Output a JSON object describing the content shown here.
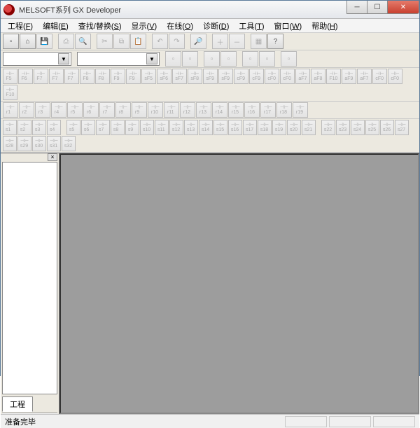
{
  "titlebar": {
    "title": "MELSOFT系列 GX Developer"
  },
  "menu": {
    "items": [
      {
        "label": "工程",
        "key": "F"
      },
      {
        "label": "编辑",
        "key": "E"
      },
      {
        "label": "查找/替换",
        "key": "S"
      },
      {
        "label": "显示",
        "key": "V"
      },
      {
        "label": "在线",
        "key": "O"
      },
      {
        "label": "诊断",
        "key": "D"
      },
      {
        "label": "工具",
        "key": "T"
      },
      {
        "label": "窗口",
        "key": "W"
      },
      {
        "label": "帮助",
        "key": "H"
      }
    ]
  },
  "toolbar1": {
    "buttons": [
      "new",
      "open",
      "save",
      "sep",
      "print",
      "preview",
      "sep",
      "cut",
      "copy",
      "paste",
      "sep",
      "undo",
      "redo",
      "sep",
      "find",
      "sep",
      "zoom-in",
      "zoom-out",
      "sep",
      "tile",
      "help"
    ]
  },
  "toolbar2": {
    "combo1": {
      "value": ""
    },
    "combo2": {
      "value": ""
    },
    "buttons": [
      "b1",
      "b2",
      "sep",
      "b3",
      "b4",
      "sep",
      "b5",
      "b6",
      "sep",
      "b7"
    ]
  },
  "toolbar3": {
    "row1": [
      "F5",
      "F6",
      "F7",
      "F7",
      "F7",
      "F8",
      "F8",
      "F9",
      "F9",
      "sF5",
      "sF6",
      "sF7",
      "sF8",
      "sF9",
      "sF9",
      "cF9",
      "cF9",
      "cF0",
      "cF0",
      "aF7",
      "aF8",
      "F10",
      "aF9",
      "aF7",
      "cF0",
      "cF0",
      "F10"
    ],
    "row2": [
      "r1",
      "r2",
      "r3",
      "r4",
      "r5",
      "r6",
      "r7",
      "r8",
      "r9",
      "r10",
      "r11",
      "r12",
      "r13",
      "r14",
      "r15",
      "r16",
      "r17",
      "r18",
      "r19"
    ],
    "row3": [
      "s1",
      "s2",
      "s3",
      "s4",
      "sep",
      "s5",
      "s6",
      "s7",
      "s8",
      "s9",
      "s10",
      "s11",
      "s12",
      "s13",
      "s14",
      "s15",
      "s16",
      "s17",
      "s18",
      "s19",
      "s20",
      "s21",
      "sep",
      "s22",
      "s23",
      "s24",
      "s25",
      "s26",
      "s27",
      "s28",
      "s29",
      "s30",
      "s31",
      "s32"
    ]
  },
  "sidebar": {
    "tab_label": "工程"
  },
  "statusbar": {
    "text": "准备完毕"
  }
}
